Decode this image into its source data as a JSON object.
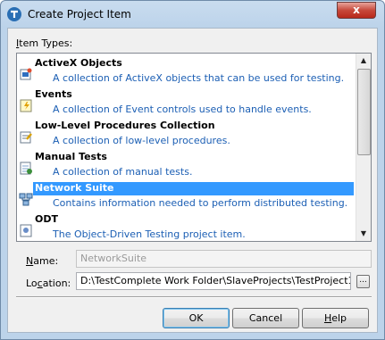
{
  "window": {
    "title": "Create Project Item",
    "close_label": "x"
  },
  "list": {
    "label": "Item Types:",
    "label_underline": "I",
    "label_rest": "tem Types:",
    "items": [
      {
        "name": "ActiveX Objects",
        "desc": "A collection of ActiveX objects that can be used for testing.",
        "icon": "activex-icon"
      },
      {
        "name": "Events",
        "desc": "A collection of Event controls used to handle events.",
        "icon": "events-icon"
      },
      {
        "name": "Low-Level Procedures Collection",
        "desc": "A collection of low-level procedures.",
        "icon": "lowlevel-procedures-icon"
      },
      {
        "name": "Manual Tests",
        "desc": "A collection of manual tests.",
        "icon": "manual-tests-icon"
      },
      {
        "name": "Network Suite",
        "desc": "Contains information needed to perform distributed testing.",
        "icon": "network-suite-icon",
        "selected": true
      },
      {
        "name": "ODT",
        "desc": "The Object-Driven Testing project item.",
        "icon": "odt-icon"
      }
    ]
  },
  "name_field": {
    "label_u": "N",
    "label_rest": "ame:",
    "value": "NetworkSuite"
  },
  "location_field": {
    "label_pre": "Lo",
    "label_u": "c",
    "label_rest": "ation:",
    "value": "D:\\TestComplete Work Folder\\SlaveProjects\\TestProject1\\",
    "browse_label": "..."
  },
  "buttons": {
    "ok": "OK",
    "cancel": "Cancel",
    "help_u": "H",
    "help_rest": "elp"
  }
}
